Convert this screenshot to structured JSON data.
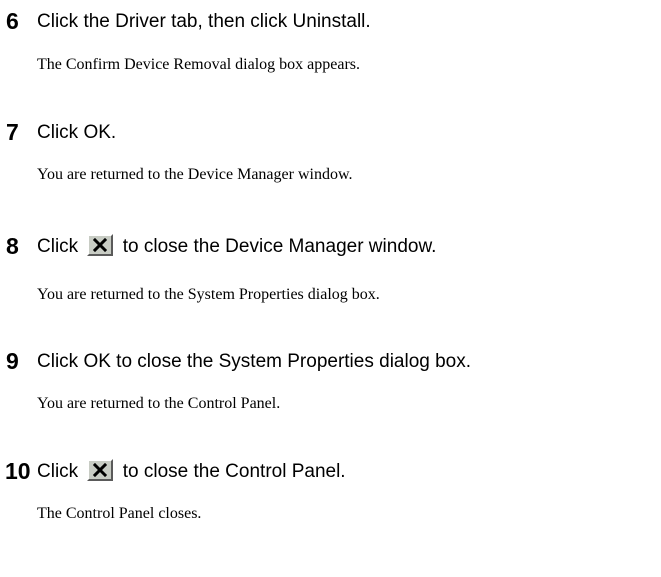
{
  "steps": [
    {
      "number": "6",
      "instruction": "Click the Driver tab, then click Uninstall.",
      "result": "The Confirm Device Removal dialog box appears."
    },
    {
      "number": "7",
      "instruction": "Click OK.",
      "result": "You are returned to the Device Manager window."
    },
    {
      "number": "8",
      "instruction_before": "Click",
      "instruction_after": "to close the Device Manager window.",
      "result": "You are returned to the System Properties dialog box."
    },
    {
      "number": "9",
      "instruction": "Click OK to close the System Properties dialog box.",
      "result": "You are returned to the Control Panel."
    },
    {
      "number": "10",
      "instruction_before": "Click",
      "instruction_after": "to close the Control Panel.",
      "result": "The Control Panel closes."
    }
  ],
  "icons": {
    "close_button": "close-x-icon"
  },
  "colors": {
    "text": "#000000",
    "button_face": "#c8ccc4"
  }
}
